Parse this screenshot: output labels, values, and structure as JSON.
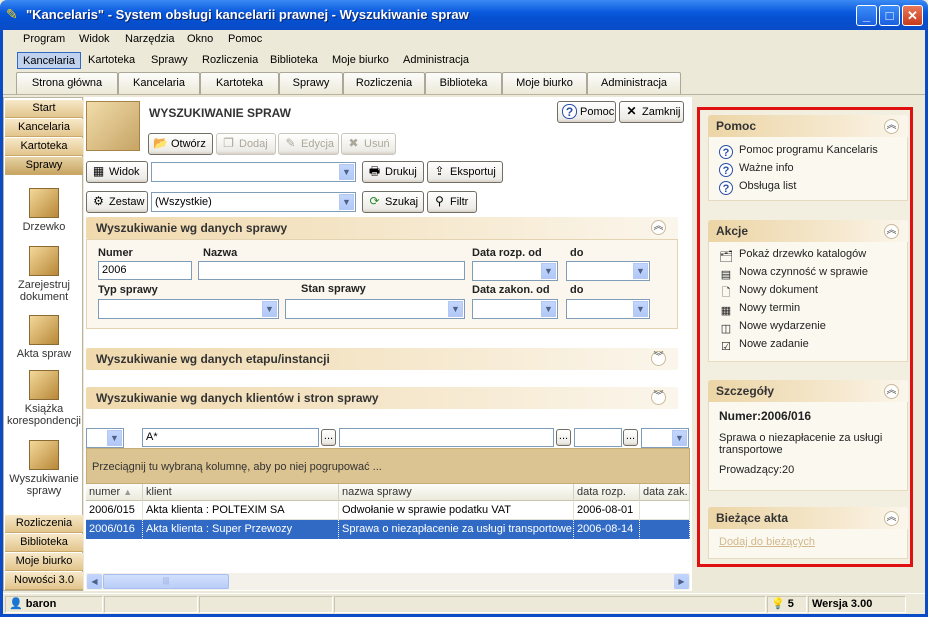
{
  "window": {
    "title": "\"Kancelaris\" - System obsługi kancelarii prawnej - Wyszukiwanie spraw",
    "buttons": [
      "minimize",
      "maximize",
      "close"
    ]
  },
  "menubar": [
    "Program",
    "Widok",
    "Narzędzia",
    "Okno",
    "Pomoc"
  ],
  "toolbar_tabs": {
    "items": [
      "Kancelaria",
      "Kartoteka",
      "Sprawy",
      "Rozliczenia",
      "Biblioteka",
      "Moje biurko",
      "Administracja"
    ],
    "selected": "Kancelaria"
  },
  "page_tabs": [
    "Strona główna",
    "Kancelaria",
    "Kartoteka",
    "Sprawy",
    "Rozliczenia",
    "Biblioteka",
    "Moje biurko",
    "Administracja"
  ],
  "leftnav": {
    "top_buttons": [
      "Start",
      "Kancelaria",
      "Kartoteka",
      "Sprawy"
    ],
    "items": [
      "Drzewko",
      "Zarejestruj dokument",
      "Akta spraw",
      "Książka korespondencji",
      "Wyszukiwanie sprawy"
    ],
    "bottom_buttons": [
      "Rozliczenia",
      "Biblioteka",
      "Moje biurko",
      "Nowości 3.0"
    ]
  },
  "header": {
    "title": "WYSZUKIWANIE SPRAW",
    "help": "Pomoc",
    "close": "Zamknij"
  },
  "actions": {
    "open": "Otwórz",
    "add": "Dodaj",
    "edit": "Edycja",
    "delete": "Usuń"
  },
  "view": {
    "label": "Widok",
    "value": "",
    "print": "Drukuj",
    "export": "Eksportuj"
  },
  "set": {
    "label": "Zestaw",
    "value": "(Wszystkie)",
    "search": "Szukaj",
    "filter": "Filtr"
  },
  "sections": {
    "case_data": {
      "title": "Wyszukiwanie wg danych sprawy",
      "numer_label": "Numer",
      "numer_value": "2006",
      "nazwa_label": "Nazwa",
      "data_rozp_od": "Data rozp. od",
      "do1": "do",
      "typ_label": "Typ sprawy",
      "stan_label": "Stan sprawy",
      "data_zakon_od": "Data zakon. od",
      "do2": "do"
    },
    "stage": {
      "title": "Wyszukiwanie wg danych etapu/instancji"
    },
    "clients": {
      "title": "Wyszukiwanie wg danych klientów i stron sprawy"
    }
  },
  "grid": {
    "filter_value": "A*",
    "group_hint": "Przeciągnij tu wybraną kolumnę, aby po niej pogrupować ...",
    "columns": [
      "numer",
      "klient",
      "nazwa sprawy",
      "data rozp.",
      "data zak."
    ],
    "sort_indicator": "▲",
    "rows": [
      {
        "numer": "2006/015",
        "klient": "Akta klienta : POLTEXIM SA",
        "nazwa": "Odwołanie w sprawie podatku VAT",
        "data_rozp": "2006-08-01",
        "data_zak": ""
      },
      {
        "numer": "2006/016",
        "klient": "Akta klienta : Super Przewozy",
        "nazwa": "Sprawa o niezapłacenie za usługi transportowe",
        "data_rozp": "2006-08-14",
        "data_zak": ""
      }
    ],
    "selected_row": 1
  },
  "right_panel": {
    "help": {
      "title": "Pomoc",
      "items": [
        "Pomoc programu Kancelaris",
        "Ważne info",
        "Obsługa list"
      ]
    },
    "actions": {
      "title": "Akcje",
      "items": [
        "Pokaż drzewko katalogów",
        "Nowa czynność w sprawie",
        "Nowy dokument",
        "Nowy termin",
        "Nowe wydarzenie",
        "Nowe zadanie"
      ]
    },
    "details": {
      "title": "Szczegóły",
      "numer": "Numer:2006/016",
      "opis": "Sprawa o niezapłacenie za usługi transportowe",
      "prowadzacy": "Prowadzący:20"
    },
    "current": {
      "title": "Bieżące akta",
      "link": "Dodaj do bieżących"
    }
  },
  "status": {
    "user": "baron",
    "count": "5",
    "version": "Wersja 3.00"
  },
  "colors": {
    "titlebar": "#0a5ade",
    "panel_border": "#e01010",
    "selection": "#316ac5",
    "section_band": "#f0d9ad"
  }
}
